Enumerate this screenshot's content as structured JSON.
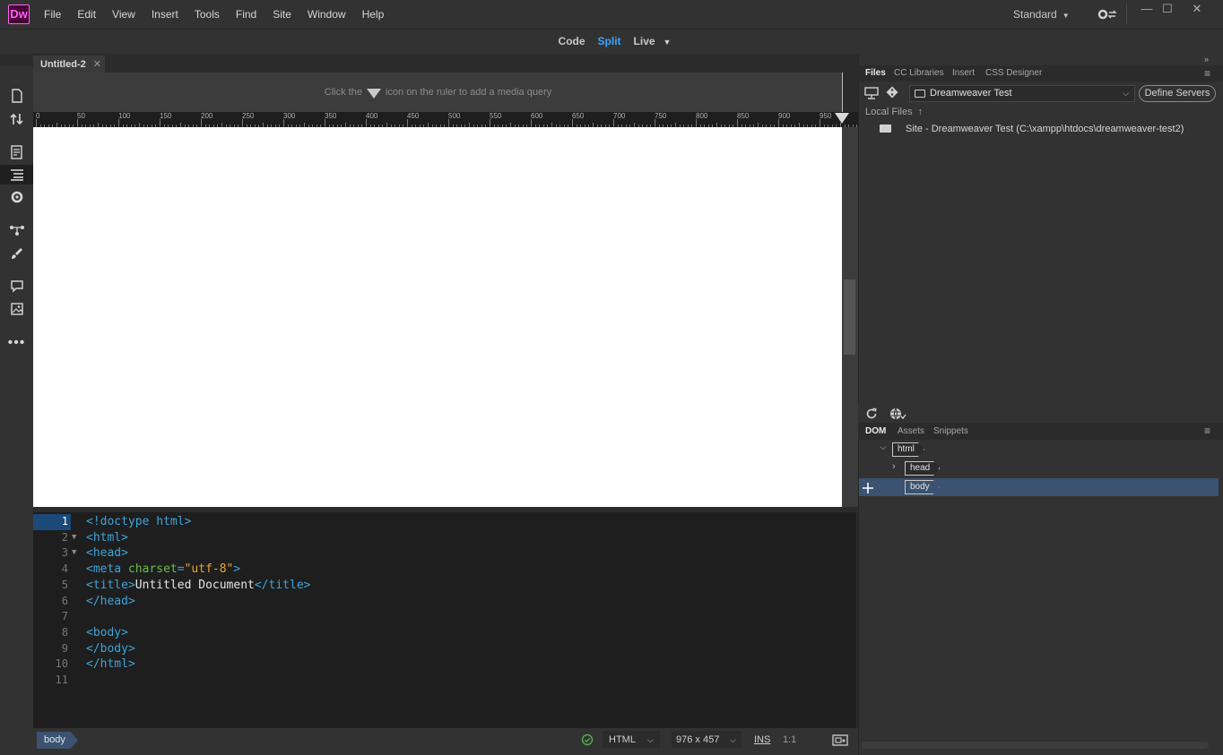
{
  "app": {
    "logo_text": "Dw",
    "accent": "#ff61f6",
    "brand_bg": "#470137"
  },
  "menu": [
    "File",
    "Edit",
    "View",
    "Insert",
    "Tools",
    "Find",
    "Site",
    "Window",
    "Help"
  ],
  "workspace": {
    "label": "Standard"
  },
  "window_controls": {
    "minimize": "—",
    "maximize": "☐",
    "close": "✕"
  },
  "view_switcher": {
    "code": "Code",
    "split": "Split",
    "live": "Live",
    "active": "Split",
    "active_color": "#3ea2ff"
  },
  "document": {
    "tab_title": "Untitled-2"
  },
  "media_query_hint": {
    "before": "Click the",
    "after": "icon on the ruler to add a media query"
  },
  "ruler": {
    "ticks": [
      "0",
      "50",
      "100",
      "150",
      "200",
      "250",
      "300",
      "350",
      "400",
      "450",
      "500",
      "550",
      "600",
      "650",
      "700",
      "750",
      "800",
      "850",
      "900",
      "950"
    ]
  },
  "left_toolbar": [
    "new-document-icon",
    "file-transfer-icon",
    "page-properties-icon",
    "outline-icon",
    "css-designer-icon",
    "dom-icon",
    "brush-icon",
    "comment-icon",
    "image-icon",
    "more-icon"
  ],
  "code": {
    "lines": [
      {
        "num": "1",
        "fold": "",
        "parts": [
          {
            "t": "tag",
            "s": "<!doctype html>"
          }
        ]
      },
      {
        "num": "2",
        "fold": "▼",
        "parts": [
          {
            "t": "tag",
            "s": "<html>"
          }
        ]
      },
      {
        "num": "3",
        "fold": "▼",
        "parts": [
          {
            "t": "tag",
            "s": "<head>"
          }
        ]
      },
      {
        "num": "4",
        "fold": "",
        "parts": [
          {
            "t": "tag",
            "s": "<meta "
          },
          {
            "t": "attr",
            "s": "charset"
          },
          {
            "t": "tag",
            "s": "="
          },
          {
            "t": "val",
            "s": "\"utf-8\""
          },
          {
            "t": "tag",
            "s": ">"
          }
        ]
      },
      {
        "num": "5",
        "fold": "",
        "parts": [
          {
            "t": "tag",
            "s": "<title>"
          },
          {
            "t": "txt",
            "s": "Untitled Document"
          },
          {
            "t": "tag",
            "s": "</title>"
          }
        ]
      },
      {
        "num": "6",
        "fold": "",
        "parts": [
          {
            "t": "tag",
            "s": "</head>"
          }
        ]
      },
      {
        "num": "7",
        "fold": "",
        "parts": []
      },
      {
        "num": "8",
        "fold": "",
        "parts": [
          {
            "t": "tag",
            "s": "<body>"
          }
        ]
      },
      {
        "num": "9",
        "fold": "",
        "parts": [
          {
            "t": "tag",
            "s": "</body>"
          }
        ]
      },
      {
        "num": "10",
        "fold": "",
        "parts": [
          {
            "t": "tag",
            "s": "</html>"
          }
        ]
      },
      {
        "num": "11",
        "fold": "",
        "parts": []
      }
    ],
    "current_line": "1"
  },
  "status_bar": {
    "tag": "body",
    "doc_type": "HTML",
    "size": "976 x 457",
    "mode": "INS",
    "position": "1:1"
  },
  "files_panel": {
    "tabs": [
      "Files",
      "CC Libraries",
      "Insert",
      "CSS Designer"
    ],
    "active_tab": "Files",
    "site": "Dreamweaver Test",
    "define_servers": "Define Servers",
    "local_files_label": "Local Files",
    "site_item": "Site - Dreamweaver Test (C:\\xampp\\htdocs\\dreamweaver-test2)"
  },
  "dom_panel": {
    "tabs": [
      "DOM",
      "Assets",
      "Snippets"
    ],
    "active_tab": "DOM",
    "nodes": {
      "html": "html",
      "head": "head",
      "body": "body"
    },
    "selected": "body"
  }
}
